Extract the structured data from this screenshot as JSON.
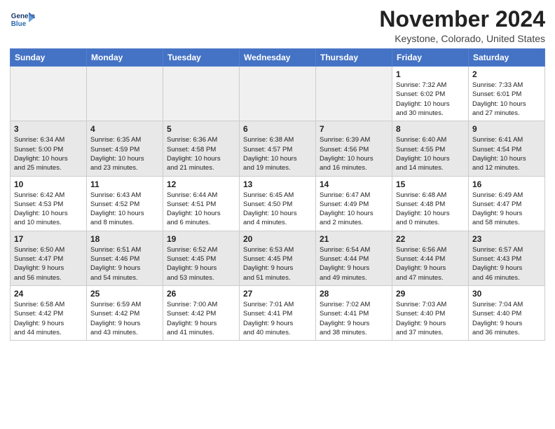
{
  "header": {
    "logo_line1": "General",
    "logo_line2": "Blue",
    "month": "November 2024",
    "location": "Keystone, Colorado, United States"
  },
  "weekdays": [
    "Sunday",
    "Monday",
    "Tuesday",
    "Wednesday",
    "Thursday",
    "Friday",
    "Saturday"
  ],
  "weeks": [
    {
      "class": "week1",
      "days": [
        {
          "num": "",
          "detail": ""
        },
        {
          "num": "",
          "detail": ""
        },
        {
          "num": "",
          "detail": ""
        },
        {
          "num": "",
          "detail": ""
        },
        {
          "num": "",
          "detail": ""
        },
        {
          "num": "1",
          "detail": "Sunrise: 7:32 AM\nSunset: 6:02 PM\nDaylight: 10 hours\nand 30 minutes."
        },
        {
          "num": "2",
          "detail": "Sunrise: 7:33 AM\nSunset: 6:01 PM\nDaylight: 10 hours\nand 27 minutes."
        }
      ]
    },
    {
      "class": "week2",
      "days": [
        {
          "num": "3",
          "detail": "Sunrise: 6:34 AM\nSunset: 5:00 PM\nDaylight: 10 hours\nand 25 minutes."
        },
        {
          "num": "4",
          "detail": "Sunrise: 6:35 AM\nSunset: 4:59 PM\nDaylight: 10 hours\nand 23 minutes."
        },
        {
          "num": "5",
          "detail": "Sunrise: 6:36 AM\nSunset: 4:58 PM\nDaylight: 10 hours\nand 21 minutes."
        },
        {
          "num": "6",
          "detail": "Sunrise: 6:38 AM\nSunset: 4:57 PM\nDaylight: 10 hours\nand 19 minutes."
        },
        {
          "num": "7",
          "detail": "Sunrise: 6:39 AM\nSunset: 4:56 PM\nDaylight: 10 hours\nand 16 minutes."
        },
        {
          "num": "8",
          "detail": "Sunrise: 6:40 AM\nSunset: 4:55 PM\nDaylight: 10 hours\nand 14 minutes."
        },
        {
          "num": "9",
          "detail": "Sunrise: 6:41 AM\nSunset: 4:54 PM\nDaylight: 10 hours\nand 12 minutes."
        }
      ]
    },
    {
      "class": "week3",
      "days": [
        {
          "num": "10",
          "detail": "Sunrise: 6:42 AM\nSunset: 4:53 PM\nDaylight: 10 hours\nand 10 minutes."
        },
        {
          "num": "11",
          "detail": "Sunrise: 6:43 AM\nSunset: 4:52 PM\nDaylight: 10 hours\nand 8 minutes."
        },
        {
          "num": "12",
          "detail": "Sunrise: 6:44 AM\nSunset: 4:51 PM\nDaylight: 10 hours\nand 6 minutes."
        },
        {
          "num": "13",
          "detail": "Sunrise: 6:45 AM\nSunset: 4:50 PM\nDaylight: 10 hours\nand 4 minutes."
        },
        {
          "num": "14",
          "detail": "Sunrise: 6:47 AM\nSunset: 4:49 PM\nDaylight: 10 hours\nand 2 minutes."
        },
        {
          "num": "15",
          "detail": "Sunrise: 6:48 AM\nSunset: 4:48 PM\nDaylight: 10 hours\nand 0 minutes."
        },
        {
          "num": "16",
          "detail": "Sunrise: 6:49 AM\nSunset: 4:47 PM\nDaylight: 9 hours\nand 58 minutes."
        }
      ]
    },
    {
      "class": "week4",
      "days": [
        {
          "num": "17",
          "detail": "Sunrise: 6:50 AM\nSunset: 4:47 PM\nDaylight: 9 hours\nand 56 minutes."
        },
        {
          "num": "18",
          "detail": "Sunrise: 6:51 AM\nSunset: 4:46 PM\nDaylight: 9 hours\nand 54 minutes."
        },
        {
          "num": "19",
          "detail": "Sunrise: 6:52 AM\nSunset: 4:45 PM\nDaylight: 9 hours\nand 53 minutes."
        },
        {
          "num": "20",
          "detail": "Sunrise: 6:53 AM\nSunset: 4:45 PM\nDaylight: 9 hours\nand 51 minutes."
        },
        {
          "num": "21",
          "detail": "Sunrise: 6:54 AM\nSunset: 4:44 PM\nDaylight: 9 hours\nand 49 minutes."
        },
        {
          "num": "22",
          "detail": "Sunrise: 6:56 AM\nSunset: 4:44 PM\nDaylight: 9 hours\nand 47 minutes."
        },
        {
          "num": "23",
          "detail": "Sunrise: 6:57 AM\nSunset: 4:43 PM\nDaylight: 9 hours\nand 46 minutes."
        }
      ]
    },
    {
      "class": "week5",
      "days": [
        {
          "num": "24",
          "detail": "Sunrise: 6:58 AM\nSunset: 4:42 PM\nDaylight: 9 hours\nand 44 minutes."
        },
        {
          "num": "25",
          "detail": "Sunrise: 6:59 AM\nSunset: 4:42 PM\nDaylight: 9 hours\nand 43 minutes."
        },
        {
          "num": "26",
          "detail": "Sunrise: 7:00 AM\nSunset: 4:42 PM\nDaylight: 9 hours\nand 41 minutes."
        },
        {
          "num": "27",
          "detail": "Sunrise: 7:01 AM\nSunset: 4:41 PM\nDaylight: 9 hours\nand 40 minutes."
        },
        {
          "num": "28",
          "detail": "Sunrise: 7:02 AM\nSunset: 4:41 PM\nDaylight: 9 hours\nand 38 minutes."
        },
        {
          "num": "29",
          "detail": "Sunrise: 7:03 AM\nSunset: 4:40 PM\nDaylight: 9 hours\nand 37 minutes."
        },
        {
          "num": "30",
          "detail": "Sunrise: 7:04 AM\nSunset: 4:40 PM\nDaylight: 9 hours\nand 36 minutes."
        }
      ]
    }
  ]
}
